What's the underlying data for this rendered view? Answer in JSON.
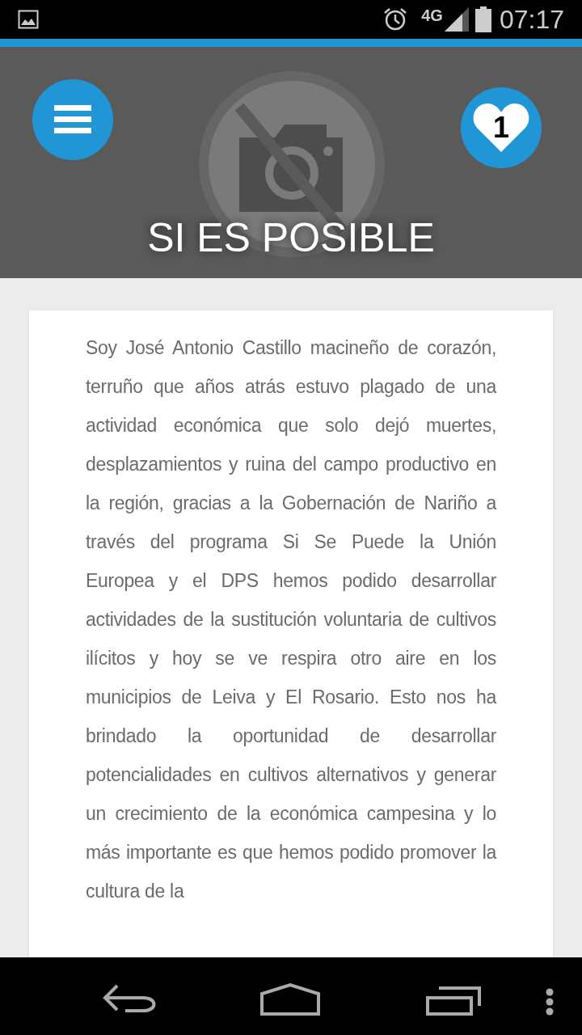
{
  "status_bar": {
    "network": "4G",
    "time": "07:17"
  },
  "header": {
    "title": "SI ES POSIBLE",
    "favorites_count": "1"
  },
  "article": {
    "text": "Soy José Antonio Castillo macineño de corazón, terruño que años atrás estuvo plagado de una actividad económica que solo dejó muertes, desplazamientos y ruina del campo productivo en la región, gracias a la Gobernación de Nariño a través del programa Si Se Puede la Unión Europea y el DPS hemos podido desarrollar actividades de la sustitución voluntaria de cultivos ilícitos y hoy se ve respira otro aire en los municipios de Leiva y El Rosario. Esto nos ha brindado la oportunidad de desarrollar potencialidades en cultivos alternativos y generar un crecimiento de la económica campesina y lo más importante es que hemos podido promover la cultura de la"
  }
}
